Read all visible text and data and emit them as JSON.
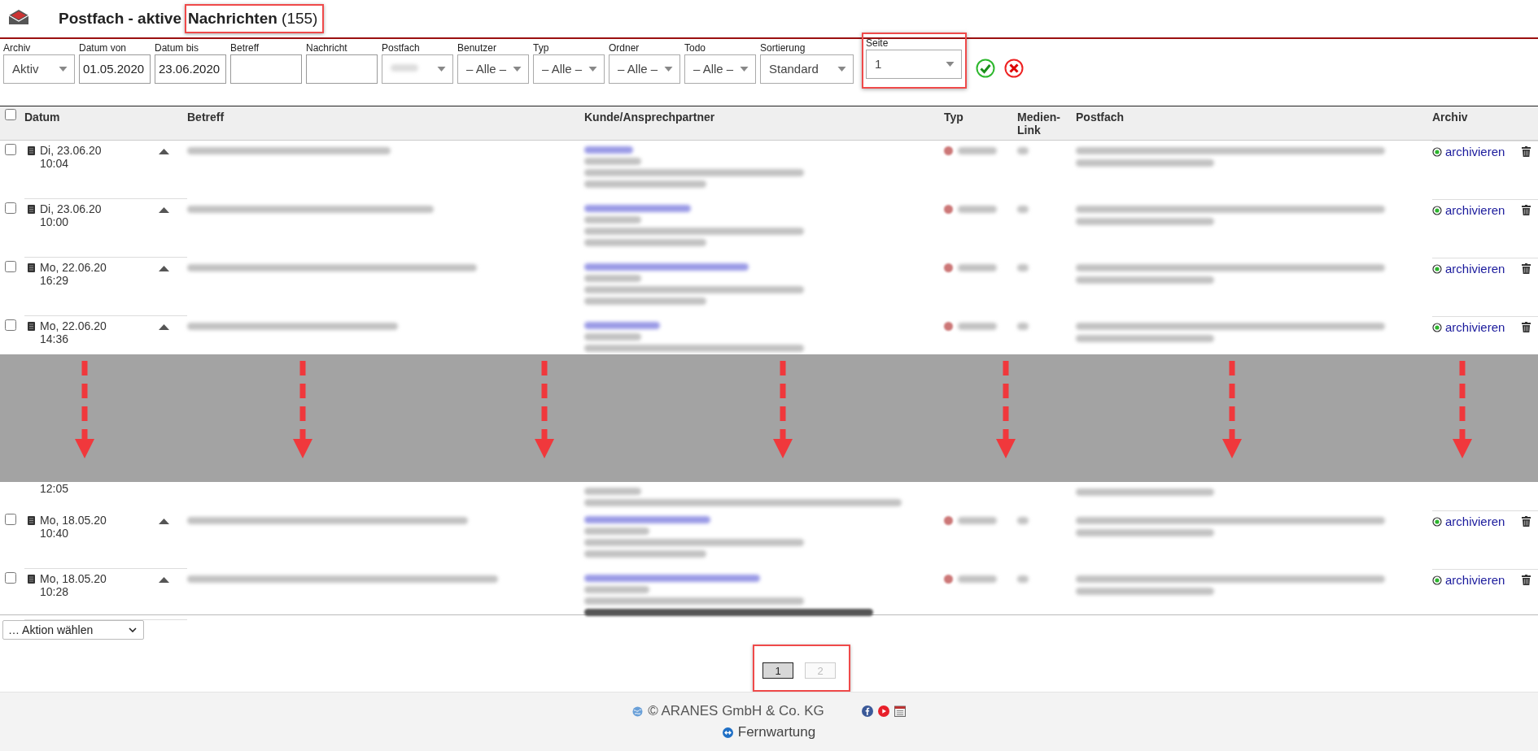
{
  "header": {
    "title": "Postfach - aktive",
    "highlighted_title": "**Nachrichten** (155)"
  },
  "filters": [
    {
      "label": "Archiv",
      "kind": "select",
      "value": "Aktiv"
    },
    {
      "label": "Datum von",
      "kind": "input",
      "value": "01.05.2020"
    },
    {
      "label": "Datum bis",
      "kind": "input",
      "value": "23.06.2020"
    },
    {
      "label": "Betreff",
      "kind": "input"
    },
    {
      "label": "Nachricht",
      "kind": "input"
    },
    {
      "label": "Postfach",
      "kind": "blurred"
    },
    {
      "label": "Benutzer",
      "kind": "select",
      "value": "– Alle –"
    },
    {
      "label": "Typ",
      "kind": "select",
      "value": "– Alle –"
    },
    {
      "label": "Ordner",
      "kind": "select",
      "value": "– Alle –"
    },
    {
      "label": "Todo",
      "kind": "select",
      "value": "– Alle –"
    },
    {
      "label": "Sortierung",
      "kind": "select",
      "value": "Standard",
      "wide": true
    },
    {
      "label": "Seite",
      "kind": "select",
      "value": "1",
      "wide": true,
      "highlighted": true
    }
  ],
  "table": {
    "select_all_checked": false,
    "columns": [
      "Datum",
      "Betreff",
      "Kunde/Ansprechpartner",
      "Typ",
      "Medien-Link",
      "Postfach",
      "Archiv"
    ],
    "rows": [
      {
        "kind": "full",
        "checked": false,
        "date": "Di, 23.06.20",
        "time": "10:04",
        "archive_link": "archivieren"
      },
      {
        "kind": "full",
        "checked": false,
        "date": "Di, 23.06.20",
        "time": "10:00",
        "archive_link": "archivieren"
      },
      {
        "kind": "full",
        "checked": false,
        "date": "Mo, 22.06.20",
        "time": "16:29",
        "archive_link": "archivieren"
      },
      {
        "kind": "cut",
        "checked": false,
        "date": "Mo, 22.06.20",
        "time": "14:36",
        "archive_link": "archivieren"
      },
      {
        "kind": "partial",
        "time": "12:05"
      },
      {
        "kind": "full",
        "checked": false,
        "date": "Mo, 18.05.20",
        "time": "10:40",
        "archive_link": "archivieren"
      },
      {
        "kind": "last",
        "checked": false,
        "date": "Mo, 18.05.20",
        "time": "10:28",
        "archive_link": "archivieren"
      }
    ]
  },
  "action_select": {
    "value": "… Aktion wählen"
  },
  "pagination": [
    {
      "label": "1",
      "selected": true
    },
    {
      "label": "2",
      "selected": false
    }
  ],
  "footer": {
    "copyright": "© ARANES GmbH & Co. KG",
    "remote_link": "Fernwartung"
  }
}
